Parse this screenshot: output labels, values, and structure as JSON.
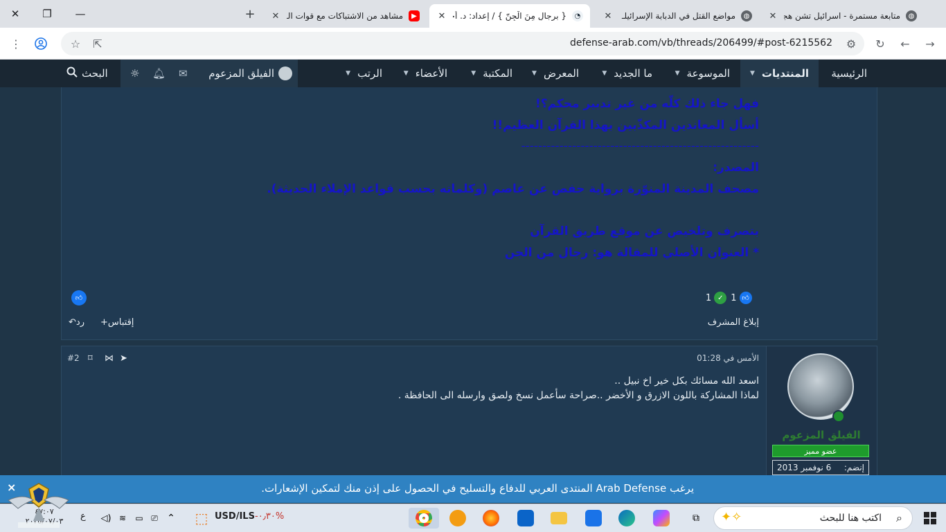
{
  "browser": {
    "tabs": [
      {
        "title": "متابعة مستمرة - اسرائيل تشن هجـ"
      },
      {
        "title": "مواضع القتل في الدبابة الإسرائيلـ"
      },
      {
        "title": "{ برجالٍ مِنَ الْجِنّ } / إعداد: د. أحمد"
      },
      {
        "title": "مشاهد من الاشتباكات مع قوات الـ"
      }
    ],
    "url": "defense-arab.com/vb/threads/206499/#post-6215562"
  },
  "forum_nav": {
    "items": [
      {
        "label": "الرئيسية"
      },
      {
        "label": "المنتديات"
      },
      {
        "label": "الموسوعة"
      },
      {
        "label": "ما الجديد"
      },
      {
        "label": "المعرض"
      },
      {
        "label": "المكتبة"
      },
      {
        "label": "الأعضاء"
      },
      {
        "label": "الرتب"
      }
    ],
    "username": "الفيلق المزعوم",
    "search_label": "البحث"
  },
  "post1": {
    "lines": [
      "فهل جاء ذلك كلّه من غير تدبير محكم؟!",
      "أسأل المعاندين المكذّبين بهذا القرآن العظيم!!",
      "--------------------------------------------------------",
      "المصدر:",
      "مصحف المدينة المنوّرة برواية حفص عن عاصم (وكلماته بحسب قواعد الإملاء الحديثة).",
      "بتصرف وتلخيص عن موقع طريق القرآن",
      "* العنوان الأصلي للمقالة هو: رجال من الجن"
    ],
    "reaction_like_count": "1",
    "reaction_agree_count": "1",
    "report_label": "إبلاغ المشرف",
    "quote_label": "إقتباس",
    "reply_label": "رد"
  },
  "post2": {
    "date": "الأمس في 01:28",
    "number": "#2",
    "lines": [
      "اسعد الله مسائك بكل خير اخ نبيل ..",
      "لماذا المشاركة باللون الازرق و الأخضر ..صراحة سأعمل نسخ ولصق وارسله الى الحافظة ."
    ],
    "author": "الفيلق المزعوم",
    "user_title": "عضو مميز",
    "joined_label": "إنضم:",
    "joined_value": "6 نوفمبر 2013"
  },
  "notification": {
    "message": "يرغب Arab Defense المنتدى العربي للدفاع والتسليح في الحصول على إذن منك لتمكين الإشعارات.",
    "close": "×"
  },
  "taskbar": {
    "search_placeholder": "اكتب هنا للبحث",
    "ticker": "USD/ILS",
    "ticker_change": "-٠٫٣٠%",
    "clock_time": "٤٧:٠٧",
    "clock_date": "٢٠٢٥/٠٧/٠٣"
  }
}
